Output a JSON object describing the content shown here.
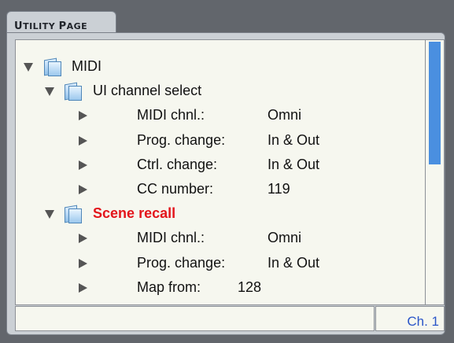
{
  "tab": {
    "title_first": "U",
    "title_rest": "TILITY",
    "title_second_first": "P",
    "title_second_rest": "AGE"
  },
  "tree": {
    "root": {
      "label": "MIDI"
    },
    "groups": [
      {
        "label": "UI channel select",
        "highlighted": false,
        "items": [
          {
            "label": "MIDI chnl.:",
            "value": "Omni"
          },
          {
            "label": "Prog. change:",
            "value": "In & Out"
          },
          {
            "label": "Ctrl. change:",
            "value": "In & Out"
          },
          {
            "label": "CC number:",
            "value": "119"
          }
        ]
      },
      {
        "label": "Scene recall",
        "highlighted": true,
        "items": [
          {
            "label": "MIDI chnl.:",
            "value": "Omni"
          },
          {
            "label": "Prog. change:",
            "value": "In & Out"
          },
          {
            "label": "Map from:",
            "value": "128"
          }
        ]
      }
    ]
  },
  "status": {
    "channel": "Ch. 1"
  },
  "colors": {
    "highlight": "#e3151b",
    "accent": "#4a8fe0",
    "status_text": "#2a55c8"
  }
}
